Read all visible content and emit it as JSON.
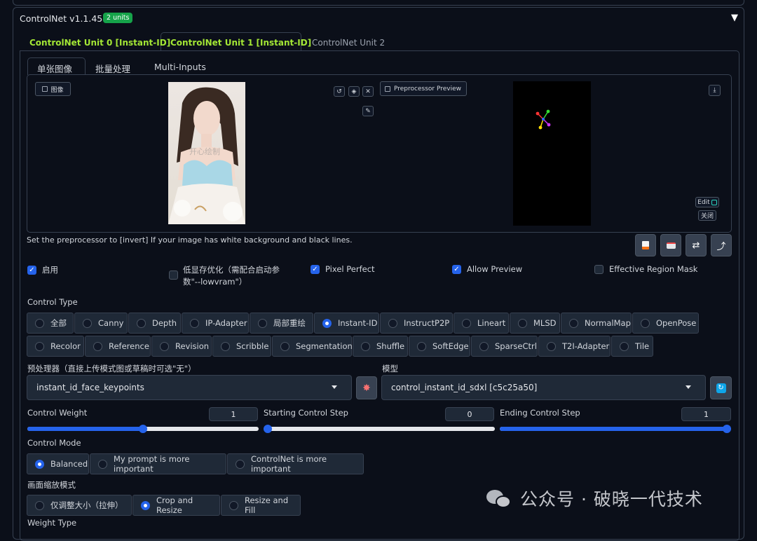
{
  "accordion": {
    "title": "ControlNet v1.1.454",
    "badge": "2 units"
  },
  "unit_tabs": [
    "ControlNet Unit 0 [Instant-ID]",
    "ControlNet Unit 1 [Instant-ID]",
    "ControlNet Unit 2"
  ],
  "sub_tabs": [
    "单张图像",
    "批量处理",
    "Multi-Inputs"
  ],
  "image_panel": {
    "image_label": "图像",
    "preview_label": "Preprocessor Preview",
    "photo_watermark": "开心绘制",
    "edit_label": "Edit",
    "close_label": "关闭"
  },
  "hint": "Set the preprocessor to [invert] If your image has white background and black lines.",
  "checkboxes": {
    "enable": {
      "label": "启用",
      "checked": true
    },
    "lowvram": {
      "label_line1": "低显存优化（需配合启动参",
      "label_line2": "数\"--lowvram\"）",
      "checked": false
    },
    "pixel_perfect": {
      "label": "Pixel Perfect",
      "checked": true
    },
    "allow_preview": {
      "label": "Allow Preview",
      "checked": true
    },
    "effective_region_mask": {
      "label": "Effective Region Mask",
      "checked": false
    }
  },
  "control_type": {
    "label": "Control Type",
    "row1": [
      "全部",
      "Canny",
      "Depth",
      "IP-Adapter",
      "局部重绘",
      "Instant-ID",
      "InstructP2P",
      "Lineart",
      "MLSD",
      "NormalMap",
      "OpenPose"
    ],
    "row2": [
      "Recolor",
      "Reference",
      "Revision",
      "Scribble",
      "Segmentation",
      "Shuffle",
      "SoftEdge",
      "SparseCtrl",
      "T2I-Adapter",
      "Tile"
    ],
    "selected": "Instant-ID"
  },
  "preprocessor": {
    "label": "预处理器（直接上传模式图或草稿时可选\"无\"）",
    "value": "instant_id_face_keypoints"
  },
  "model": {
    "label": "模型",
    "value": "control_instant_id_sdxl [c5c25a50]"
  },
  "sliders": {
    "weight": {
      "label": "Control Weight",
      "value": "1",
      "fraction": 0.5
    },
    "start": {
      "label": "Starting Control Step",
      "value": "0",
      "fraction": 0.0
    },
    "end": {
      "label": "Ending Control Step",
      "value": "1",
      "fraction": 1.0
    }
  },
  "control_mode": {
    "label": "Control Mode",
    "options": [
      "Balanced",
      "My prompt is more important",
      "ControlNet is more important"
    ],
    "selected": "Balanced"
  },
  "resize_mode": {
    "label": "画面缩放模式",
    "options": [
      "仅调整大小（拉伸）",
      "Crop and Resize",
      "Resize and Fill"
    ],
    "selected": "Crop and Resize"
  },
  "weight_type": {
    "label": "Weight Type"
  },
  "watermark": {
    "text": "公众号 · 破晓一代技术"
  },
  "colors": {
    "accent": "#2563eb",
    "tab_label": "#a3e635",
    "badge": "#16a34a",
    "background": "#0b0f19"
  }
}
